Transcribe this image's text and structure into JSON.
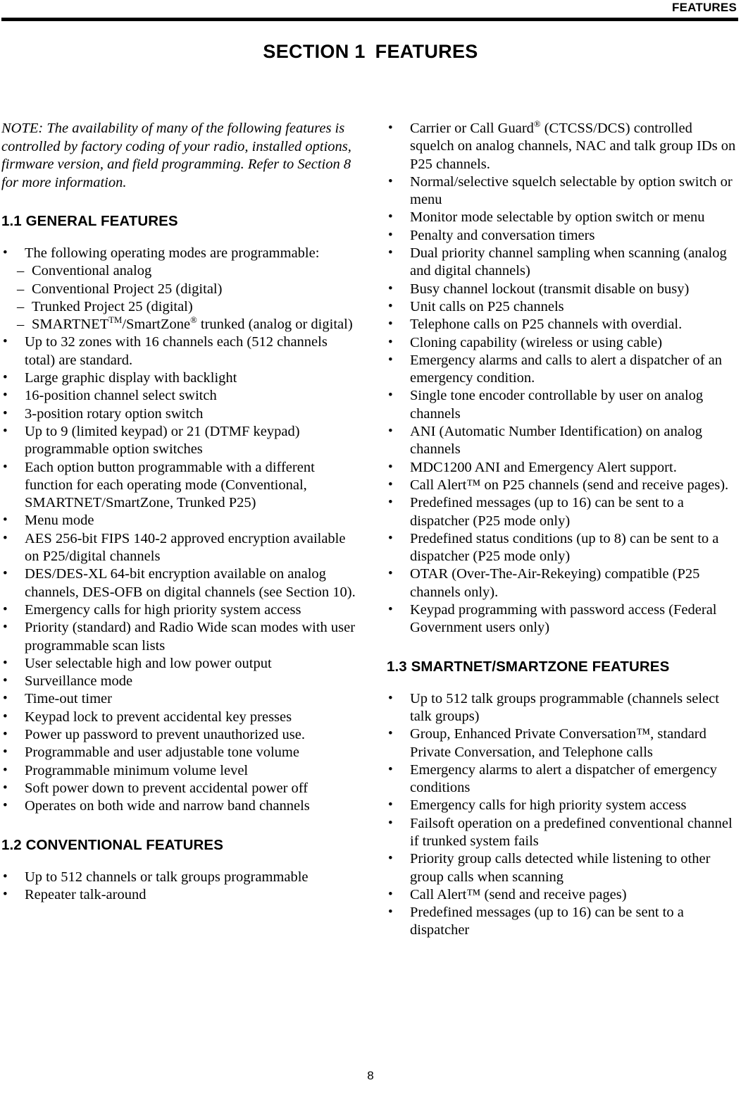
{
  "header": {
    "running_title": "FEATURES"
  },
  "section_title": {
    "number": "SECTION 1",
    "name": "FEATURES"
  },
  "note": "NOTE: The availability of many of the following features is controlled by factory coding of your radio, installed options, firmware version, and field programming. Refer to Section 8 for more information.",
  "sections": {
    "general": {
      "heading": "1.1 GENERAL FEATURES",
      "items": [
        "The following operating modes are programmable:",
        "Up to 32 zones with 16 channels each (512 channels total) are standard.",
        "Large graphic display with backlight",
        "16-position channel select switch",
        "3-position rotary option switch",
        "Up to 9 (limited keypad) or 21 (DTMF keypad) programmable option switches",
        "Each option button programmable with a different function for each operating mode (Conventional, SMARTNET/SmartZone, Trunked P25)",
        "Menu mode",
        "AES 256-bit FIPS 140-2 approved encryption available on P25/digital channels",
        "DES/DES-XL 64-bit encryption available on analog channels, DES-OFB on digital channels (see Section 10).",
        "Emergency calls for high priority system access",
        "Priority (standard) and Radio Wide scan modes with user programmable scan lists",
        "User selectable high and low power output",
        "Surveillance mode",
        "Time-out timer",
        "Keypad lock to prevent accidental key presses",
        "Power up password to prevent unauthorized use.",
        "Programmable and user adjustable tone volume",
        "Programmable minimum volume level",
        "Soft power down to prevent accidental power off",
        "Operates on both wide and narrow band channels"
      ],
      "operating_modes": {
        "mode_1": "Conventional analog",
        "mode_2": "Conventional Project 25 (digital)",
        "mode_3": "Trunked Project 25 (digital)",
        "mode_4_pre": "SMARTNET",
        "mode_4_tm": "TM",
        "mode_4_mid": "/SmartZone",
        "mode_4_reg": "®",
        "mode_4_post": " trunked (analog or digital)"
      }
    },
    "conventional": {
      "heading": "1.2 CONVENTIONAL FEATURES",
      "items": [
        "Up to 512 channels or talk groups programmable",
        "Repeater talk-around",
        "Normal/selective squelch selectable by option switch or menu",
        "Monitor mode selectable by option switch or menu",
        "Penalty and conversation timers",
        "Dual priority channel sampling when scanning (analog and digital channels)",
        "Busy channel lockout (transmit disable on busy)",
        "Unit calls on P25 channels",
        "Telephone calls on P25 channels with overdial.",
        "Cloning capability (wireless or using cable)",
        "Emergency alarms and calls to alert a dispatcher of an emergency condition.",
        "Single tone encoder controllable by user on analog channels",
        "ANI (Automatic Number Identification) on analog channels",
        "MDC1200 ANI and Emergency Alert support.",
        "Call Alert™ on P25 channels (send and receive pages).",
        "Predefined messages (up to 16) can be sent to a dispatcher (P25 mode only)",
        "Predefined status conditions (up to 8) can be sent to a dispatcher (P25 mode only)",
        "OTAR (Over-The-Air-Rekeying) compatible (P25 channels only).",
        "Keypad programming with password access (Federal Government users only)"
      ],
      "call_guard": {
        "pre": "Carrier or Call Guard",
        "reg": "®",
        "post": " (CTCSS/DCS) controlled squelch on analog channels, NAC and talk group IDs on P25 channels."
      }
    },
    "smartnet": {
      "heading": "1.3 SMARTNET/SMARTZONE FEATURES",
      "items": [
        "Up to 512 talk groups programmable (channels select talk groups)",
        "Group, Enhanced Private Conversation™, standard Private Conversation, and Telephone calls",
        "Emergency alarms to alert a dispatcher of emergency conditions",
        "Emergency calls for high priority system access",
        "Failsoft operation on a predefined conventional channel if trunked system fails",
        "Priority group calls detected while listening to other group calls when scanning",
        "Call Alert™ (send and receive pages)",
        "Predefined messages (up to 16) can be sent to a dispatcher"
      ]
    }
  },
  "footer": {
    "page_number": "8"
  }
}
